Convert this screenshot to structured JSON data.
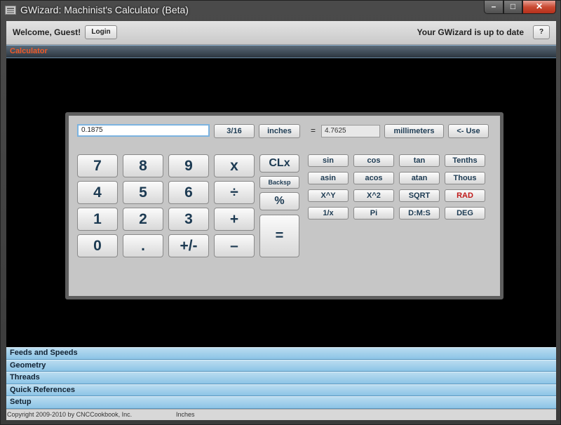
{
  "window": {
    "title": "GWizard: Machinist's Calculator (Beta)"
  },
  "topbar": {
    "welcome": "Welcome, Guest!",
    "login_label": "Login",
    "status": "Your GWizard is up to date",
    "help_label": "?"
  },
  "calculator": {
    "header": "Calculator",
    "input_value": "0.1875",
    "fraction_label": "3/16",
    "input_unit": "inches",
    "equals": "=",
    "output_value": "4.7625",
    "output_unit": "millimeters",
    "use_label": "<- Use",
    "digits": [
      "7",
      "8",
      "9",
      "4",
      "5",
      "6",
      "1",
      "2",
      "3",
      "0",
      "."
    ],
    "ops": {
      "mul": "x",
      "div": "÷",
      "add": "+",
      "sub": "–",
      "sign": "+/-",
      "clx": "CLx",
      "backsp": "Backsp",
      "pct": "%",
      "eq": "="
    },
    "functions": [
      [
        "sin",
        "cos",
        "tan",
        "Tenths"
      ],
      [
        "asin",
        "acos",
        "atan",
        "Thous"
      ],
      [
        "X^Y",
        "X^2",
        "SQRT",
        "RAD"
      ],
      [
        "1/x",
        "Pi",
        "D:M:S",
        "DEG"
      ]
    ],
    "accent_red": "#c01818"
  },
  "nav": [
    "Feeds and Speeds",
    "Geometry",
    "Threads",
    "Quick References",
    "Setup"
  ],
  "statusbar": {
    "copyright": "Copyright 2009-2010 by CNCCookbook, Inc.",
    "units": "Inches"
  }
}
